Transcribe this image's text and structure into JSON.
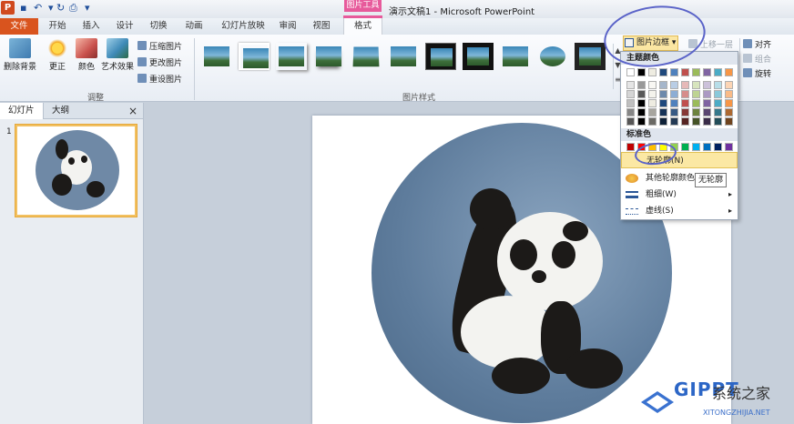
{
  "titlebar": {
    "app_icon": "P",
    "document_title": "演示文稿1 - Microsoft PowerPoint",
    "context_tools_label": "图片工具"
  },
  "tabs": {
    "file": "文件",
    "items": [
      "开始",
      "插入",
      "设计",
      "切换",
      "动画",
      "幻灯片放映",
      "审阅",
      "视图",
      "格式"
    ]
  },
  "ribbon": {
    "adjust_group": {
      "label": "调整",
      "remove_bg": "删除背景",
      "correct": "更正",
      "color": "颜色",
      "art_effects": "艺术效果",
      "compress": "压缩图片",
      "change": "更改图片",
      "reset": "重设图片"
    },
    "styles_group": {
      "label": "图片样式"
    },
    "border_button": "图片边框",
    "bring_forward": "上移一层",
    "align": "对齐",
    "group": "组合",
    "rotate": "旋转"
  },
  "left_pane": {
    "tab_slides": "幻灯片",
    "tab_outline": "大纲",
    "close_glyph": "×",
    "slide_number": "1"
  },
  "border_menu": {
    "theme_header": "主题颜色",
    "standard_header": "标准色",
    "no_outline": "无轮廓(N)",
    "more_colors": "其他轮廓颜色",
    "weight": "粗细(W)",
    "dashes": "虚线(S)",
    "theme_colors_top": [
      "#ffffff",
      "#000000",
      "#eeece1",
      "#1f497d",
      "#4f81bd",
      "#c0504d",
      "#9bbb59",
      "#8064a2",
      "#4bacc6",
      "#f79646"
    ],
    "standard_colors": [
      "#c00000",
      "#ff0000",
      "#ffc000",
      "#ffff00",
      "#92d050",
      "#00b050",
      "#00b0f0",
      "#0070c0",
      "#002060",
      "#7030a0"
    ]
  },
  "tooltip": "无轮廓",
  "watermark": {
    "main": "GIPPT",
    "side": "系统之家",
    "sub": "XITONGZHIJIA.NET"
  }
}
